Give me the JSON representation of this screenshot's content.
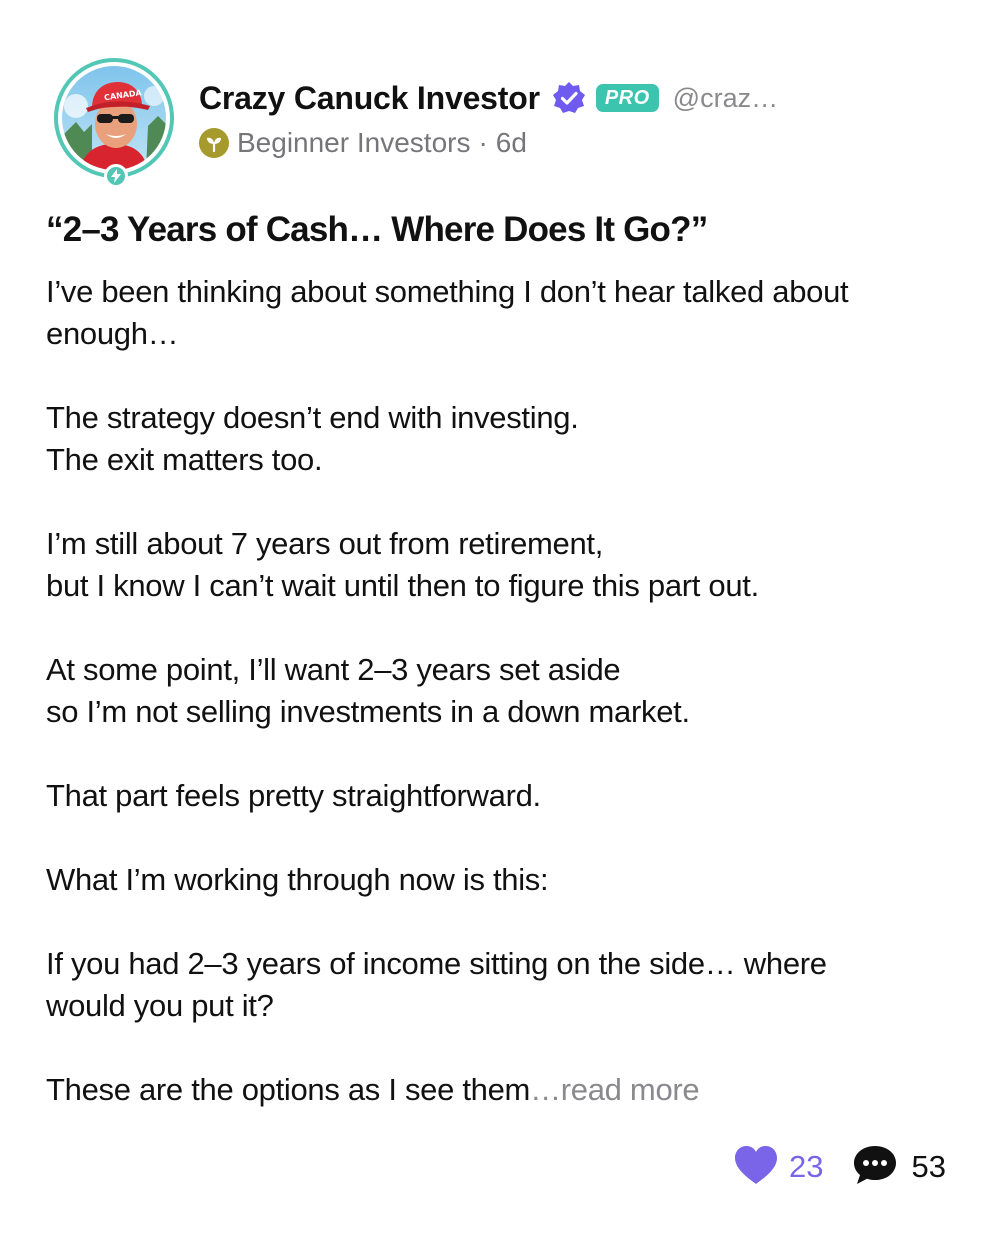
{
  "author": {
    "name": "Crazy Canuck Investor",
    "badge": "PRO",
    "handle": "@craz…",
    "avatar_cap_text": "CANADA"
  },
  "meta": {
    "community": "Beginner Investors",
    "separator": "·",
    "age": "6d"
  },
  "post": {
    "title": "“2–3 Years of Cash… Where Does It Go?”",
    "paragraphs": [
      [
        "I’ve been thinking about something I don’t hear talked about",
        "enough…"
      ],
      [
        "The strategy doesn’t end with investing.",
        "The exit matters too."
      ],
      [
        "I’m still about 7 years out from retirement,",
        "but I know I can’t wait until then to figure this part out."
      ],
      [
        "At some point, I’ll want 2–3 years set aside",
        "so I’m not selling investments in a down market."
      ],
      [
        "That part feels pretty straightforward."
      ],
      [
        "What I’m working through now is this:"
      ],
      [
        "If you had 2–3 years of income sitting on the side… where",
        "would you put it?"
      ]
    ],
    "last_line": "These are the options as I see them",
    "read_more": "…read more"
  },
  "actions": {
    "likes": "23",
    "comments": "53"
  },
  "icons": {
    "verified": "verified-check-icon",
    "community": "sprout-icon",
    "avatar_badge": "lightning-icon",
    "like": "heart-icon",
    "comment": "chat-bubble-icon"
  },
  "colors": {
    "accent_teal": "#3cc4ae",
    "verified_purple": "#6f5bf0",
    "like_purple": "#7a64e8",
    "community_olive": "#a59a2b",
    "muted_text": "#8a8a8e"
  }
}
